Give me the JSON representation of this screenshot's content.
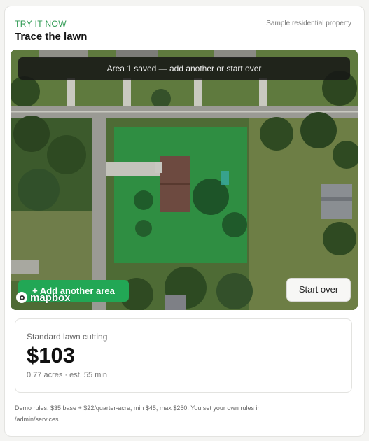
{
  "header": {
    "eyebrow": "TRY IT NOW",
    "title": "Trace the lawn",
    "sample_label": "Sample residential property"
  },
  "map": {
    "toast": "Area 1 saved — add another or start over",
    "add_area_label": "+ Add another area",
    "start_over_label": "Start over",
    "attribution": "mapbox",
    "traced_area_color": "#1fa24a"
  },
  "quote": {
    "service": "Standard lawn cutting",
    "price": "$103",
    "details": "0.77 acres · est. 55 min"
  },
  "footer": {
    "rules_text": "Demo rules: $35 base + $22/quarter-acre, min $45, max $250. You set your own rules in /admin/services."
  }
}
